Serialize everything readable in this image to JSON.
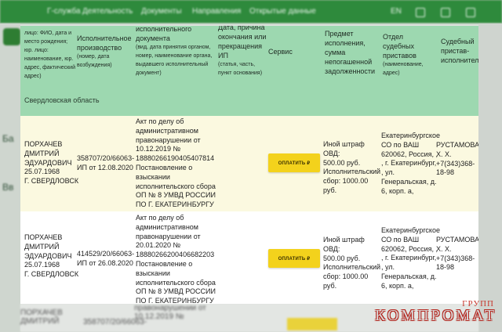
{
  "background_nav": {
    "items": [
      "Г-служба",
      "Деятельность",
      "Документы",
      "Направления",
      "Открытые данные"
    ],
    "lang": "EN"
  },
  "background_left": [
    "Ба",
    "Вв"
  ],
  "table": {
    "headers": [
      {
        "main": "",
        "sub": "лицо: ФИО, дата и место рождения; юр. лицо: наименование, юр. адрес, фактический адрес)"
      },
      {
        "main": "Исполнительное производство",
        "sub": "(номер, дата возбуждения)"
      },
      {
        "main": "исполнительного документа",
        "sub": "(вид, дата принятия органом, номер, наименование органа, выдавшего исполнительный документ)"
      },
      {
        "main": "Дата, причина окончания или прекращения ИП",
        "sub": "(статья, часть, пункт основания)"
      },
      {
        "main": "Сервис",
        "sub": ""
      },
      {
        "main": "Предмет исполнения, сумма непогашенной задолженности",
        "sub": ""
      },
      {
        "main": "Отдел судебных приставов",
        "sub": "(наименование, адрес)"
      },
      {
        "main": "Судебный пристав-исполнитель",
        "sub": ""
      }
    ],
    "region": "Свердловская область",
    "pay_label": "ОПЛАТИТЬ ₽",
    "rows": [
      {
        "debtor": "ПОРХАЧЕВ\nДМИТРИЙ\nЭДУАРДОВИЧ\n25.07.1968\nГ. СВЕРДЛОВСК",
        "proceeding": "358707/20/66063-\nИП от 12.08.2020",
        "document": "Акт по делу об\nадминистративном\nправонарушении от\n10.12.2019 №\n18880266190405407814\nПостановление о\nвзыскании\nисполнительского сбора\nОП № 8 УМВД РОССИИ\nПО Г. ЕКАТЕРИНБУРГУ",
        "end": "",
        "subject": "Иной штраф ОВД:\n500.00 руб.\nИсполнительский\nсбор: 1000.00\nруб.",
        "department": "Екатеринбургское\nСО по ВАШ\n620062, Россия, ,\n, г. Екатеринбург,\n, ул.\nГенеральская, д.\n6, корп. а,",
        "bailiff": "РУСТАМОВА\nХ. Х.\n+7(343)368-\n18-98"
      },
      {
        "debtor": "ПОРХАЧЕВ\nДМИТРИЙ\nЭДУАРДОВИЧ\n25.07.1968\nГ. СВЕРДЛОВСК",
        "proceeding": "414529/20/66063-\nИП от 26.08.2020",
        "document": "Акт по делу об\nадминистративном\nправонарушении от\n20.01.2020 №\n18880266200406682203\nПостановление о\nвзыскании\nисполнительского сбора\nОП № 8 УМВД РОССИИ\nПО Г. ЕКАТЕРИНБУРГУ",
        "end": "",
        "subject": "Иной штраф ОВД:\n500.00 руб.\nИсполнительский\nсбор: 1000.00\nруб.",
        "department": "Екатеринбургское\nСО по ВАШ\n620062, Россия, ,\n, г. Екатеринбург,\n, ул.\nГенеральская, д.\n6, корп. а,",
        "bailiff": "РУСТАМОВА\nХ. Х.\n+7(343)368-\n18-98"
      }
    ]
  },
  "background_bottom": {
    "debtor": "ПОРХАЧЕВ\nДМИТРИЙ",
    "proceeding": "358707/20/66063-",
    "document": "правонарушении от\n10.12.2019 №"
  },
  "watermark": {
    "small": "ГРУПП",
    "big": "КОМПРОМАТ"
  },
  "colors": {
    "header_bg": "#9dd8b0",
    "row_odd": "#fbf9e0",
    "pay_button": "#f3d21c",
    "nav_green": "#2e8a3c"
  }
}
